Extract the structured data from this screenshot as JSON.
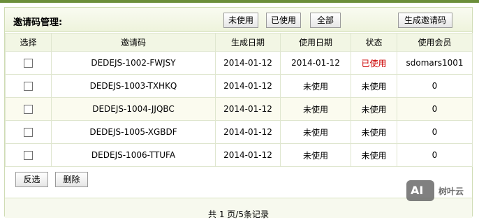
{
  "header": {
    "title": "邀请码管理:",
    "filter_unused": "未使用",
    "filter_used": "已使用",
    "filter_all": "全部",
    "generate_button": "生成邀请码"
  },
  "table": {
    "columns": [
      "选择",
      "邀请码",
      "生成日期",
      "使用日期",
      "状态",
      "使用会员"
    ],
    "rows": [
      {
        "code": "DEDEJS-1002-FWJSY",
        "created": "2014-01-12",
        "used_date": "2014-01-12",
        "status": "已使用",
        "member": "sdomars1001"
      },
      {
        "code": "DEDEJS-1003-TXHKQ",
        "created": "2014-01-12",
        "used_date": "未使用",
        "status": "未使用",
        "member": "0"
      },
      {
        "code": "DEDEJS-1004-JJQBC",
        "created": "2014-01-12",
        "used_date": "未使用",
        "status": "未使用",
        "member": "0"
      },
      {
        "code": "DEDEJS-1005-XGBDF",
        "created": "2014-01-12",
        "used_date": "未使用",
        "status": "未使用",
        "member": "0"
      },
      {
        "code": "DEDEJS-1006-TTUFA",
        "created": "2014-01-12",
        "used_date": "未使用",
        "status": "未使用",
        "member": "0"
      }
    ]
  },
  "actions": {
    "invert_select": "反选",
    "delete": "删除"
  },
  "pager": {
    "text": "共 1 页/5条记录"
  },
  "watermark": {
    "logo_text": "AI",
    "brand": "树叶云"
  },
  "colors": {
    "accent_green": "#6b8e3a",
    "used_status": "#cc0000"
  }
}
